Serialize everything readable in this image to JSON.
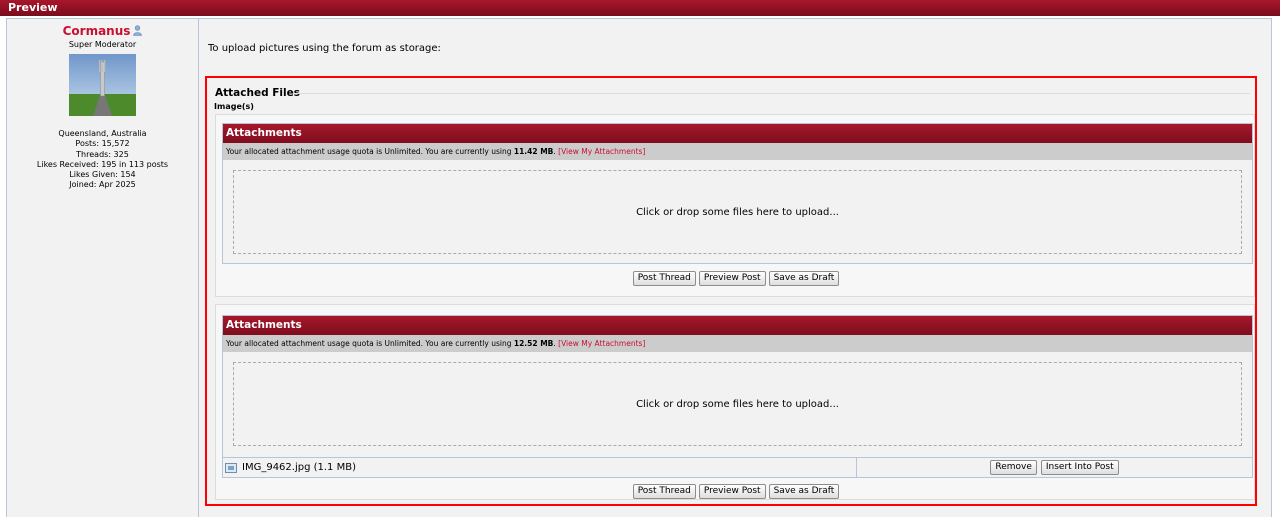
{
  "header": {
    "title": "Preview"
  },
  "user": {
    "name": "Cormanus",
    "title": "Super Moderator",
    "location": "Queensland, Australia",
    "posts": "Posts: 15,572",
    "threads": "Threads: 325",
    "likes_received": "Likes Received: 195 in 113 posts",
    "likes_given": "Likes Given: 154",
    "joined": "Joined: Apr 2025"
  },
  "post": {
    "intro": "To upload pictures using the forum as storage:",
    "fieldset_legend": "Attached Files",
    "fieldset_sub": "Image(s)"
  },
  "attachments1": {
    "header": "Attachments",
    "quota_prefix": "Your allocated attachment usage quota is Unlimited. You are currently using",
    "quota_amount": "11.42 MB",
    "quota_suffix": ".",
    "view_link": "[View My Attachments]",
    "dropzone": "Click or drop some files here to upload..."
  },
  "attachments2": {
    "header": "Attachments",
    "quota_prefix": "Your allocated attachment usage quota is Unlimited. You are currently using",
    "quota_amount": "12.52 MB",
    "quota_suffix": ".",
    "view_link": "[View My Attachments]",
    "dropzone": "Click or drop some files here to upload...",
    "file_name": "IMG_9462.jpg (1.1 MB)",
    "remove_label": "Remove",
    "insert_label": "Insert Into Post"
  },
  "buttons": {
    "post_thread": "Post Thread",
    "preview_post": "Preview Post",
    "save_draft": "Save as Draft"
  },
  "colors": {
    "brand": "#a8172c",
    "highlight_box": "#ff0000",
    "link": "#c8102e"
  }
}
